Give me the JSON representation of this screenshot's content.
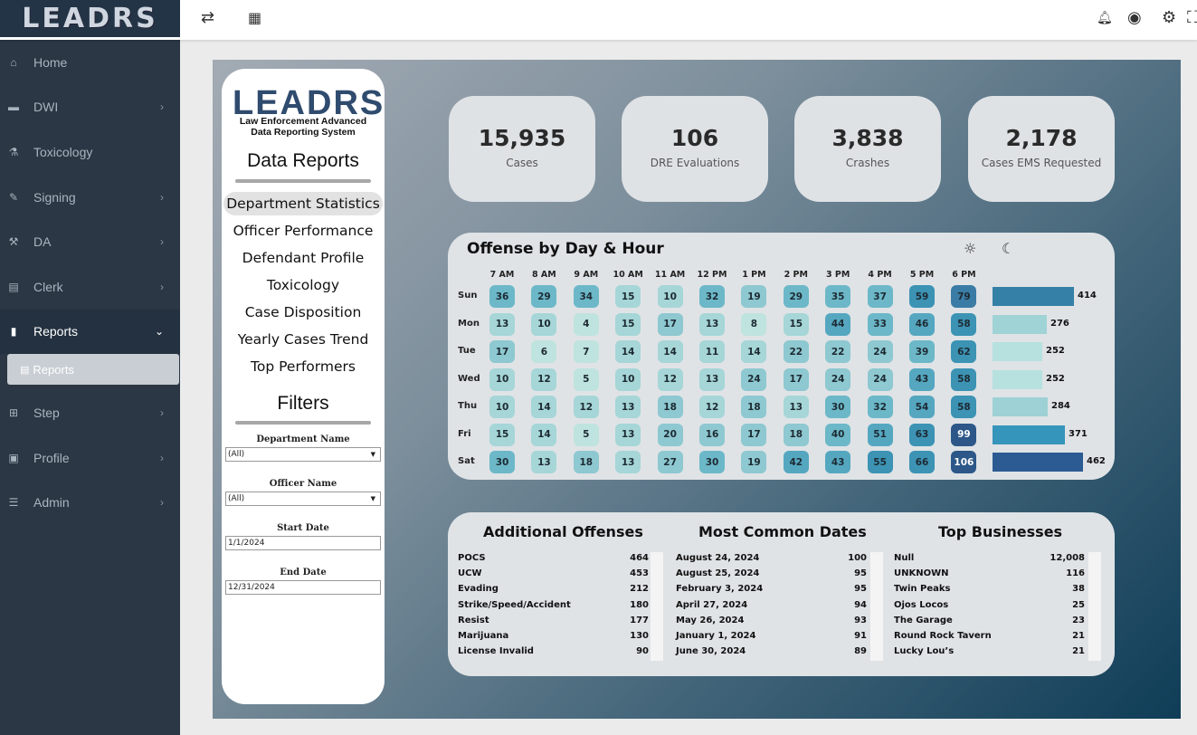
{
  "topbar": {
    "brand": "LEADRS",
    "icons": [
      "swap-icon",
      "grid-icon",
      "bell-icon",
      "user-icon",
      "gear-icon",
      "expand-icon"
    ]
  },
  "sidebar": {
    "items": [
      {
        "label": "Home",
        "icon": "home-icon",
        "chevron": false
      },
      {
        "label": "DWI",
        "icon": "car-icon",
        "chevron": true
      },
      {
        "label": "Toxicology",
        "icon": "flask-icon",
        "chevron": false
      },
      {
        "label": "Signing",
        "icon": "edit-icon",
        "chevron": true
      },
      {
        "label": "DA",
        "icon": "gavel-icon",
        "chevron": true
      },
      {
        "label": "Clerk",
        "icon": "book-icon",
        "chevron": true
      },
      {
        "label": "Reports",
        "icon": "file-icon",
        "chevron": true,
        "expanded": true
      },
      {
        "label": "Step",
        "icon": "calendar-icon",
        "chevron": true
      },
      {
        "label": "Profile",
        "icon": "id-card-icon",
        "chevron": true
      },
      {
        "label": "Admin",
        "icon": "sliders-icon",
        "chevron": true
      }
    ],
    "sub_item": "Reports"
  },
  "left_panel": {
    "logo": "LEADRS",
    "subtitle_1": "Law Enforcement Advanced",
    "subtitle_2": "Data Reporting System",
    "reports_heading": "Data Reports",
    "links": [
      "Department Statistics",
      "Officer Performance",
      "Defendant Profile",
      "Toxicology",
      "Case Disposition",
      "Yearly Cases Trend",
      "Top Performers"
    ],
    "filters_heading": "Filters",
    "filters": {
      "department_label": "Department Name",
      "department_value": "(All)",
      "officer_label": "Officer Name",
      "officer_value": "(All)",
      "start_label": "Start Date",
      "start_value": "1/1/2024",
      "end_label": "End Date",
      "end_value": "12/31/2024"
    }
  },
  "kpis": [
    {
      "value": "15,935",
      "label": "Cases"
    },
    {
      "value": "106",
      "label": "DRE Evaluations"
    },
    {
      "value": "3,838",
      "label": "Crashes"
    },
    {
      "value": "2,178",
      "label": "Cases EMS Requested"
    }
  ],
  "heatmap": {
    "title": "Offense by Day & Hour",
    "hours": [
      "7 AM",
      "8 AM",
      "9 AM",
      "10 AM",
      "11 AM",
      "12 PM",
      "1 PM",
      "2 PM",
      "3 PM",
      "4 PM",
      "5 PM",
      "6 PM"
    ],
    "days": [
      "Sun",
      "Mon",
      "Tue",
      "Wed",
      "Thu",
      "Fri",
      "Sat"
    ],
    "values": [
      [
        36,
        29,
        34,
        15,
        10,
        32,
        19,
        29,
        35,
        37,
        59,
        79
      ],
      [
        13,
        10,
        4,
        15,
        17,
        13,
        8,
        15,
        44,
        33,
        46,
        58
      ],
      [
        17,
        6,
        7,
        14,
        14,
        11,
        14,
        22,
        22,
        24,
        39,
        62
      ],
      [
        10,
        12,
        5,
        10,
        12,
        13,
        24,
        17,
        24,
        24,
        43,
        58
      ],
      [
        10,
        14,
        12,
        13,
        18,
        12,
        18,
        13,
        30,
        32,
        54,
        58
      ],
      [
        15,
        14,
        5,
        13,
        20,
        16,
        17,
        18,
        40,
        51,
        63,
        99
      ],
      [
        30,
        13,
        18,
        13,
        27,
        30,
        19,
        42,
        43,
        55,
        66,
        106
      ]
    ],
    "totals": [
      "414",
      "276",
      "252",
      "252",
      "284",
      "371",
      "462"
    ],
    "bar_colors": [
      "#3580a6",
      "#a0d3d6",
      "#b6e1de",
      "#b6e1de",
      "#9ed1d5",
      "#3595bb",
      "#2b5b92"
    ]
  },
  "additional_offenses": {
    "title": "Additional Offenses",
    "rows": [
      [
        "POCS",
        "464"
      ],
      [
        "UCW",
        "453"
      ],
      [
        "Evading",
        "212"
      ],
      [
        "Strike/Speed/Accident",
        "180"
      ],
      [
        "Resist",
        "177"
      ],
      [
        "Marijuana",
        "130"
      ],
      [
        "License Invalid",
        "90"
      ]
    ]
  },
  "common_dates": {
    "title": "Most Common Dates",
    "rows": [
      [
        "August 24, 2024",
        "100"
      ],
      [
        "August 25, 2024",
        "95"
      ],
      [
        "February 3, 2024",
        "95"
      ],
      [
        "April 27, 2024",
        "94"
      ],
      [
        "May 26, 2024",
        "93"
      ],
      [
        "January 1, 2024",
        "91"
      ],
      [
        "June 30, 2024",
        "89"
      ]
    ]
  },
  "top_businesses": {
    "title": "Top Businesses",
    "rows": [
      [
        "Null",
        "12,008"
      ],
      [
        "UNKNOWN",
        "116"
      ],
      [
        "Twin Peaks",
        "38"
      ],
      [
        "Ojos Locos",
        "25"
      ],
      [
        "The Garage",
        "23"
      ],
      [
        "Round Rock Tavern",
        "21"
      ],
      [
        "Lucky Lou’s",
        "21"
      ]
    ]
  }
}
